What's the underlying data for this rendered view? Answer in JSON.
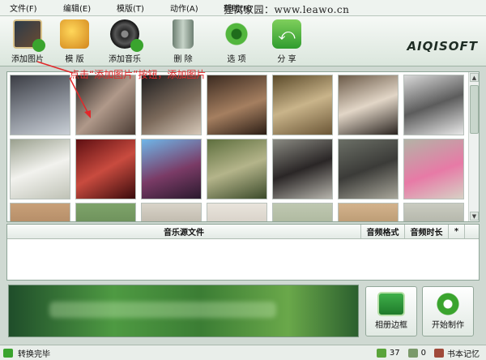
{
  "menu": {
    "items": [
      "文件(F)",
      "编辑(E)",
      "模版(T)",
      "动作(A)",
      "帮助(H)"
    ],
    "watermark": "狸窝家园：www.leawo.cn"
  },
  "toolbar": {
    "buttons": [
      {
        "label": "添加图片",
        "icon": "add-image-icon"
      },
      {
        "label": "模 版",
        "icon": "template-icon"
      },
      {
        "label": "添加音乐",
        "icon": "add-music-icon"
      },
      {
        "label": "删 除",
        "icon": "trash-icon"
      },
      {
        "label": "选 项",
        "icon": "gear-icon"
      },
      {
        "label": "分 享",
        "icon": "share-icon"
      }
    ],
    "logo": "AIQISOFT"
  },
  "annotation": {
    "text": "点击“添加图片”按钮，添加图片",
    "color": "#e2282a"
  },
  "music_table": {
    "columns": [
      "音乐源文件",
      "音频格式",
      "音频时长",
      "*"
    ]
  },
  "actions": {
    "add_frame_label": "相册边框",
    "start_label": "开始制作"
  },
  "status": {
    "text": "转换完毕",
    "image_count": "37",
    "music_count": "0",
    "notebook_label": "书本记忆"
  },
  "colors": {
    "accent_green": "#3aa42e",
    "annotation_red": "#e2282a"
  }
}
